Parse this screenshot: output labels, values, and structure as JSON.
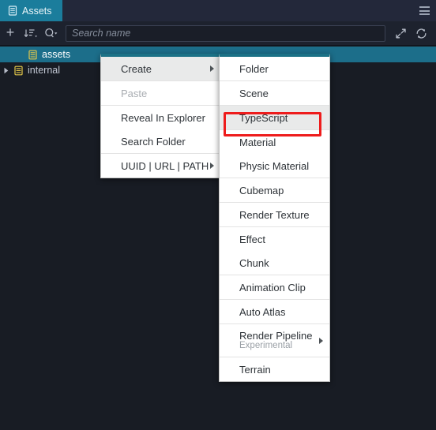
{
  "window": {
    "tab_label": "Assets",
    "tab_icon": "database-icon",
    "menu_icon": "hamburger-icon",
    "accent_color": "#1b7d9c",
    "panel_background": "#181c24"
  },
  "toolbar": {
    "add_icon": "plus-icon",
    "sort_icon": "sort-icon",
    "filter_icon": "search-filter-icon",
    "expand_icon": "expand-arrows-icon",
    "refresh_icon": "refresh-icon",
    "search": {
      "placeholder": "Search name",
      "value": ""
    }
  },
  "tree": {
    "items": [
      {
        "label": "assets",
        "icon": "database-icon",
        "selected": true,
        "expandable": false,
        "expanded": false,
        "indent": 18
      },
      {
        "label": "internal",
        "icon": "database-icon",
        "selected": false,
        "expandable": true,
        "expanded": false,
        "indent": 0
      }
    ]
  },
  "context_menu": {
    "items": [
      {
        "label": "Create",
        "highlighted": true,
        "disabled": false,
        "submenu": true
      },
      {
        "label": "Paste",
        "highlighted": false,
        "disabled": true,
        "submenu": false
      },
      {
        "label": "Reveal In Explorer",
        "highlighted": false,
        "disabled": false,
        "submenu": false
      },
      {
        "label": "Search Folder",
        "highlighted": false,
        "disabled": false,
        "submenu": false
      },
      {
        "label": "UUID | URL | PATH",
        "highlighted": false,
        "disabled": false,
        "submenu": true
      }
    ]
  },
  "create_submenu": {
    "items": [
      {
        "label": "Folder",
        "note": "",
        "highlighted": false,
        "submenu": false
      },
      {
        "label": "Scene",
        "note": "",
        "highlighted": false,
        "submenu": false
      },
      {
        "label": "TypeScript",
        "note": "",
        "highlighted": true,
        "submenu": false
      },
      {
        "label": "Material",
        "note": "",
        "highlighted": false,
        "submenu": false
      },
      {
        "label": "Physic Material",
        "note": "",
        "highlighted": false,
        "submenu": false
      },
      {
        "label": "Cubemap",
        "note": "",
        "highlighted": false,
        "submenu": false
      },
      {
        "label": "Render Texture",
        "note": "",
        "highlighted": false,
        "submenu": false
      },
      {
        "label": "Effect",
        "note": "",
        "highlighted": false,
        "submenu": false
      },
      {
        "label": "Chunk",
        "note": "",
        "highlighted": false,
        "submenu": false
      },
      {
        "label": "Animation Clip",
        "note": "",
        "highlighted": false,
        "submenu": false
      },
      {
        "label": "Auto Atlas",
        "note": "",
        "highlighted": false,
        "submenu": false
      },
      {
        "label": "Render Pipeline",
        "note": "Experimental",
        "highlighted": false,
        "submenu": true
      },
      {
        "label": "Terrain",
        "note": "",
        "highlighted": false,
        "submenu": false
      }
    ]
  },
  "annotation": {
    "target": "TypeScript",
    "color": "#ee1c1c"
  }
}
